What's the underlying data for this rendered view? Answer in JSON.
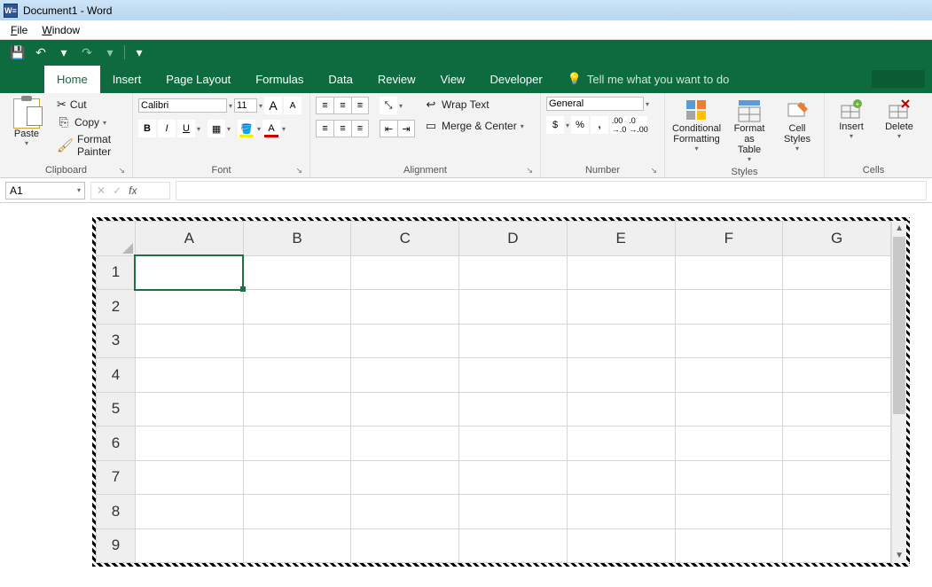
{
  "titlebar": {
    "title": "Document1 - Word",
    "word_badge": "W≡"
  },
  "menubar": {
    "file": "File",
    "window": "Window"
  },
  "tabs": {
    "home": "Home",
    "insert": "Insert",
    "page_layout": "Page Layout",
    "formulas": "Formulas",
    "data": "Data",
    "review": "Review",
    "view": "View",
    "developer": "Developer",
    "tellme": "Tell me what you want to do"
  },
  "ribbon": {
    "clipboard": {
      "label": "Clipboard",
      "paste": "Paste",
      "cut": "Cut",
      "copy": "Copy",
      "format_painter": "Format Painter"
    },
    "font": {
      "label": "Font",
      "name": "Calibri",
      "size": "11",
      "grow": "A",
      "shrink": "A",
      "bold": "B",
      "italic": "I",
      "underline": "U"
    },
    "alignment": {
      "label": "Alignment",
      "wrap": "Wrap Text",
      "merge": "Merge & Center"
    },
    "number": {
      "label": "Number",
      "format": "General",
      "currency": "$",
      "percent": "%",
      "comma": ","
    },
    "styles": {
      "label": "Styles",
      "cond": "Conditional Formatting",
      "fat": "Format as Table",
      "cell": "Cell Styles"
    },
    "cells": {
      "label": "Cells",
      "insert": "Insert",
      "delete": "Delete"
    }
  },
  "formula_bar": {
    "name_box": "A1",
    "fx": "fx"
  },
  "sheet": {
    "cols": [
      "A",
      "B",
      "C",
      "D",
      "E",
      "F",
      "G"
    ],
    "rows": [
      "1",
      "2",
      "3",
      "4",
      "5",
      "6",
      "7",
      "8",
      "9"
    ],
    "selected": "A1"
  }
}
